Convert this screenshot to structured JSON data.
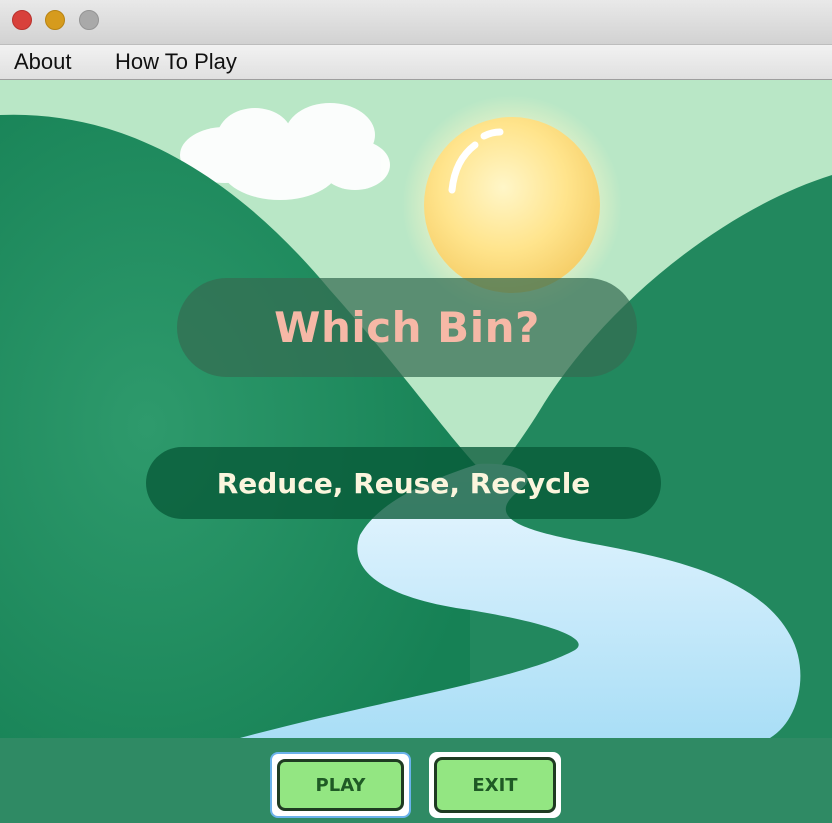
{
  "window": {
    "controls": [
      "close",
      "minimize",
      "zoom"
    ]
  },
  "menu": {
    "items": [
      "About",
      "How To Play"
    ]
  },
  "game": {
    "title": "Which Bin?",
    "subtitle": "Reduce, Reuse, Recycle"
  },
  "buttons": {
    "play": "PLAY",
    "exit": "EXIT"
  },
  "colors": {
    "background": "#2f8a64",
    "title_text": "#f6b8a6",
    "subtitle_text": "#fbf5dd",
    "button_fill": "#93e682",
    "button_text": "#1f5a25"
  }
}
